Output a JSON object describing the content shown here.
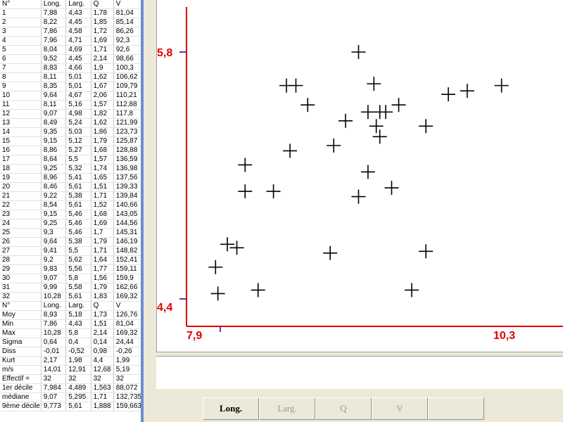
{
  "table": {
    "columns": [
      "N°",
      "Long.",
      "Larg.",
      "Q",
      "V"
    ],
    "rows": [
      [
        "1",
        "7,88",
        "4,43",
        "1,78",
        "81,04"
      ],
      [
        "2",
        "8,22",
        "4,45",
        "1,85",
        "85,14"
      ],
      [
        "3",
        "7,86",
        "4,58",
        "1,72",
        "86,26"
      ],
      [
        "4",
        "7,96",
        "4,71",
        "1,69",
        "92,3"
      ],
      [
        "5",
        "8,04",
        "4,69",
        "1,71",
        "92,6"
      ],
      [
        "6",
        "9,52",
        "4,45",
        "2,14",
        "98,66"
      ],
      [
        "7",
        "8,83",
        "4,66",
        "1,9",
        "100,3"
      ],
      [
        "8",
        "8,11",
        "5,01",
        "1,62",
        "106,62"
      ],
      [
        "9",
        "8,35",
        "5,01",
        "1,67",
        "109,79"
      ],
      [
        "10",
        "9,64",
        "4,67",
        "2,06",
        "110,21"
      ],
      [
        "11",
        "8,11",
        "5,16",
        "1,57",
        "112,88"
      ],
      [
        "12",
        "9,07",
        "4,98",
        "1,82",
        "117,8"
      ],
      [
        "13",
        "8,49",
        "5,24",
        "1,62",
        "121,99"
      ],
      [
        "14",
        "9,35",
        "5,03",
        "1,86",
        "123,73"
      ],
      [
        "15",
        "9,15",
        "5,12",
        "1,79",
        "125,87"
      ],
      [
        "16",
        "8,86",
        "5,27",
        "1,68",
        "128,88"
      ],
      [
        "17",
        "8,64",
        "5,5",
        "1,57",
        "136,59"
      ],
      [
        "18",
        "9,25",
        "5,32",
        "1,74",
        "136,98"
      ],
      [
        "19",
        "8,96",
        "5,41",
        "1,65",
        "137,56"
      ],
      [
        "20",
        "8,46",
        "5,61",
        "1,51",
        "139,33"
      ],
      [
        "21",
        "9,22",
        "5,38",
        "1,71",
        "139,84"
      ],
      [
        "22",
        "8,54",
        "5,61",
        "1,52",
        "140,66"
      ],
      [
        "23",
        "9,15",
        "5,46",
        "1,68",
        "143,05"
      ],
      [
        "24",
        "9,25",
        "5,46",
        "1,69",
        "144,56"
      ],
      [
        "25",
        "9,3",
        "5,46",
        "1,7",
        "145,31"
      ],
      [
        "26",
        "9,64",
        "5,38",
        "1,79",
        "146,19"
      ],
      [
        "27",
        "9,41",
        "5,5",
        "1,71",
        "148,82"
      ],
      [
        "28",
        "9,2",
        "5,62",
        "1,64",
        "152,41"
      ],
      [
        "29",
        "9,83",
        "5,56",
        "1,77",
        "159,11"
      ],
      [
        "30",
        "9,07",
        "5,8",
        "1,56",
        "159,9"
      ],
      [
        "31",
        "9,99",
        "5,58",
        "1,79",
        "162,66"
      ],
      [
        "32",
        "10,28",
        "5,61",
        "1,83",
        "169,32"
      ]
    ],
    "stats": [
      [
        "N°",
        "Long.",
        "Larg.",
        "Q",
        "V"
      ],
      [
        "Moy",
        "8,93",
        "5,18",
        "1,73",
        "126,76"
      ],
      [
        "Min",
        "7,86",
        "4,43",
        "1,51",
        "81,04"
      ],
      [
        "Max",
        "10,28",
        "5,8",
        "2,14",
        "169,32"
      ],
      [
        "Sigma",
        "0,64",
        "0,4",
        "0,14",
        "24,44"
      ],
      [
        "Diss",
        "-0,01",
        "-0,52",
        "0,98",
        "-0,26"
      ],
      [
        "Kurt",
        "2,17",
        "1,98",
        "4,4",
        "1,99"
      ],
      [
        "m/s",
        "14,01",
        "12,91",
        "12,68",
        "5,19"
      ],
      [
        "Effectif =",
        "32",
        "32",
        "32",
        "32"
      ],
      [
        "1er décile",
        "7,984",
        "4,489",
        "1,563",
        "88,072"
      ],
      [
        "médiane",
        "9,07",
        "5,295",
        "1,71",
        "132,735"
      ],
      [
        "9ème décile",
        "9,773",
        "5,61",
        "1,888",
        "159,663"
      ]
    ]
  },
  "chart_data": {
    "type": "scatter",
    "x_axis_labels": [
      "7,9",
      "10,3"
    ],
    "y_axis_labels": [
      "5,8",
      "4,4"
    ],
    "xlim": [
      7.9,
      10.3
    ],
    "ylim": [
      4.4,
      5.8
    ],
    "marker": "plus",
    "axis_color": "#dd0000",
    "points": [
      [
        7.88,
        4.43
      ],
      [
        8.22,
        4.45
      ],
      [
        7.86,
        4.58
      ],
      [
        7.96,
        4.71
      ],
      [
        8.04,
        4.69
      ],
      [
        9.52,
        4.45
      ],
      [
        8.83,
        4.66
      ],
      [
        8.11,
        5.01
      ],
      [
        8.35,
        5.01
      ],
      [
        9.64,
        4.67
      ],
      [
        8.11,
        5.16
      ],
      [
        9.07,
        4.98
      ],
      [
        8.49,
        5.24
      ],
      [
        9.35,
        5.03
      ],
      [
        9.15,
        5.12
      ],
      [
        8.86,
        5.27
      ],
      [
        8.64,
        5.5
      ],
      [
        9.25,
        5.32
      ],
      [
        8.96,
        5.41
      ],
      [
        8.46,
        5.61
      ],
      [
        9.22,
        5.38
      ],
      [
        8.54,
        5.61
      ],
      [
        9.15,
        5.46
      ],
      [
        9.25,
        5.46
      ],
      [
        9.3,
        5.46
      ],
      [
        9.64,
        5.38
      ],
      [
        9.41,
        5.5
      ],
      [
        9.2,
        5.62
      ],
      [
        9.83,
        5.56
      ],
      [
        9.07,
        5.8
      ],
      [
        9.99,
        5.58
      ],
      [
        10.28,
        5.61
      ]
    ]
  },
  "buttons": [
    {
      "label": "Long.",
      "state": "active"
    },
    {
      "label": "Larg.",
      "state": "disabled"
    },
    {
      "label": "Q",
      "state": "disabled"
    },
    {
      "label": "V",
      "state": "disabled"
    },
    {
      "label": "",
      "state": "disabled"
    }
  ]
}
